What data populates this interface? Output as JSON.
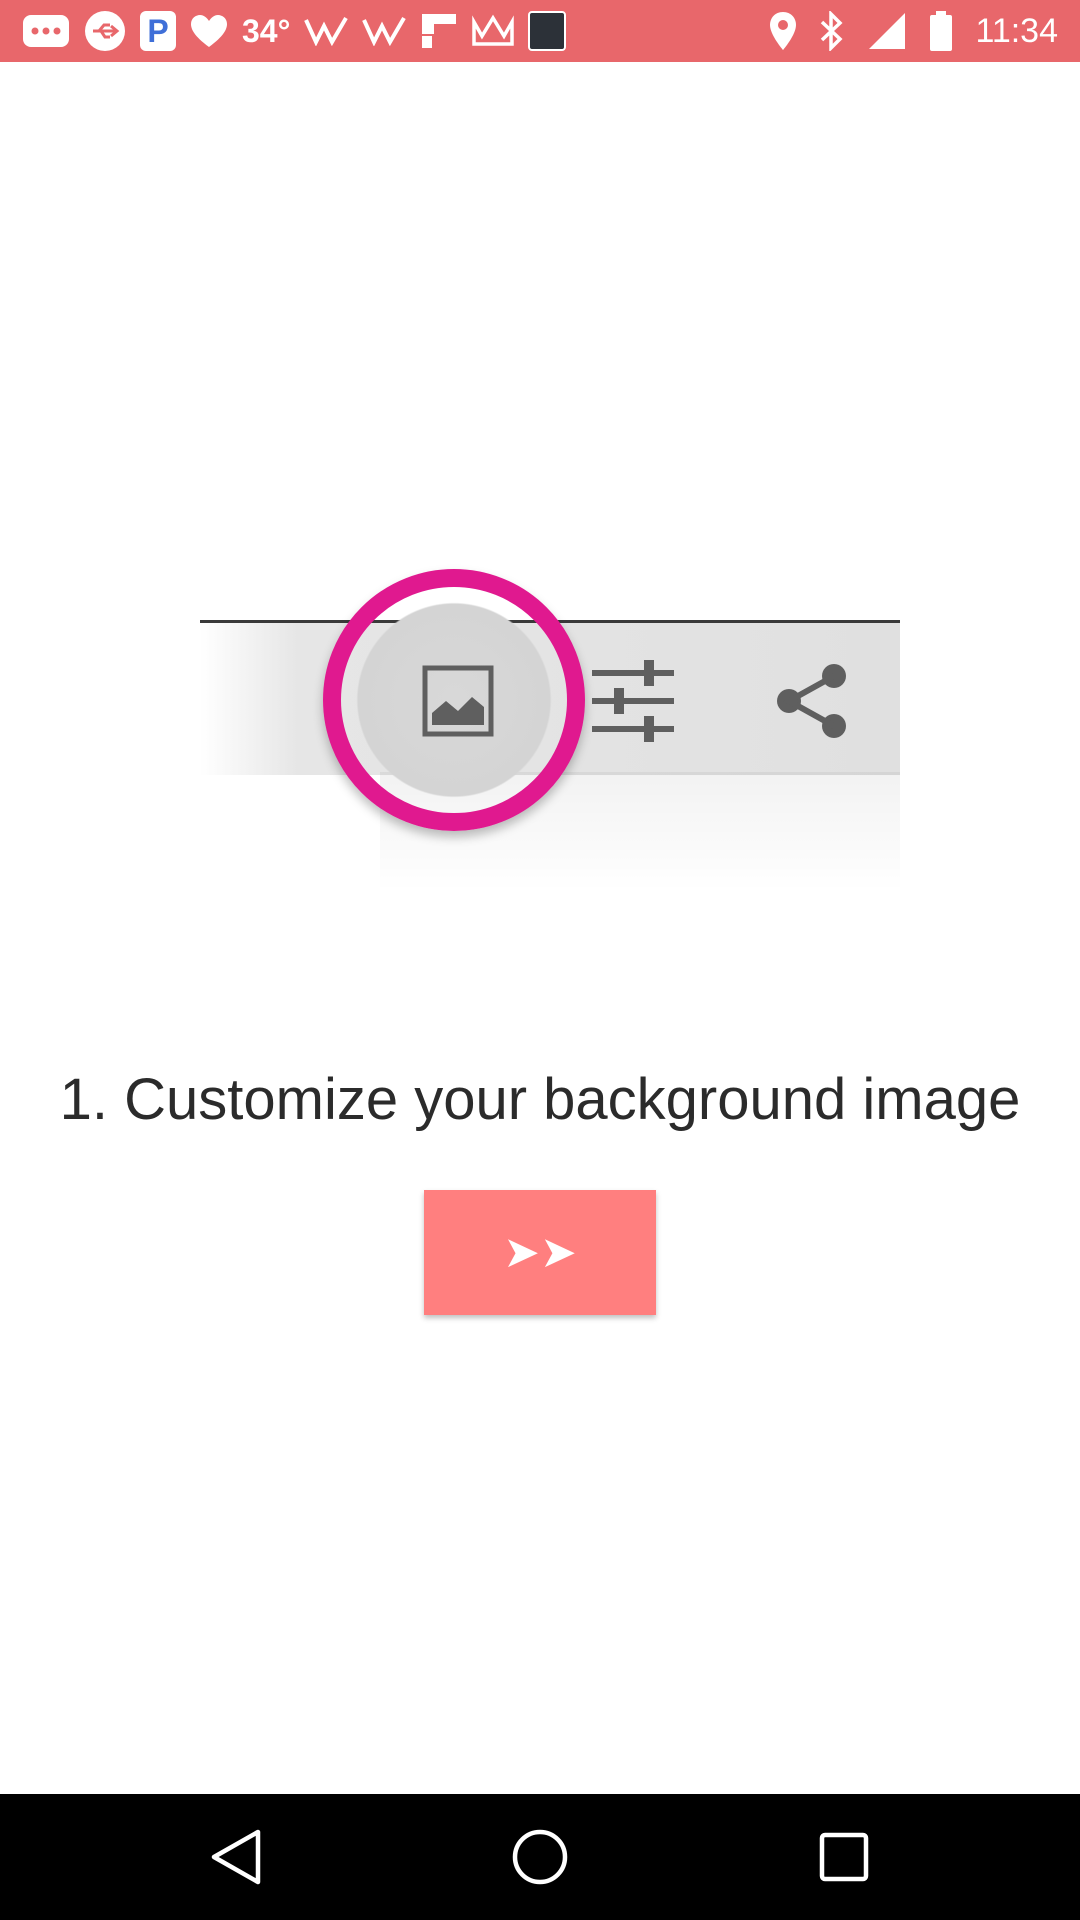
{
  "status_bar": {
    "temperature": "34°",
    "time": "11:34",
    "app_icons": [
      "more-notifications-icon",
      "usb-icon",
      "pandora-icon",
      "heart-icon",
      "weather-temp",
      "w-icon",
      "w-icon",
      "flipboard-icon",
      "crown-icon",
      "bible-app-icon"
    ],
    "system_icons": [
      "location-icon",
      "bluetooth-icon",
      "signal-icon",
      "battery-icon"
    ],
    "pandora_letter": "P"
  },
  "illustration": {
    "icons": [
      "image-icon",
      "sliders-icon",
      "share-icon"
    ],
    "highlight_color": "#e0198f"
  },
  "main": {
    "heading": "1. Customize your background image",
    "next_button_label": "➤➤",
    "button_color": "#ff7f7f"
  },
  "colors": {
    "status_bar": "#e8676b",
    "background": "#ffffff",
    "nav_bar": "#000000"
  },
  "nav_bar": {
    "buttons": [
      "back-icon",
      "home-icon",
      "recents-icon"
    ]
  }
}
